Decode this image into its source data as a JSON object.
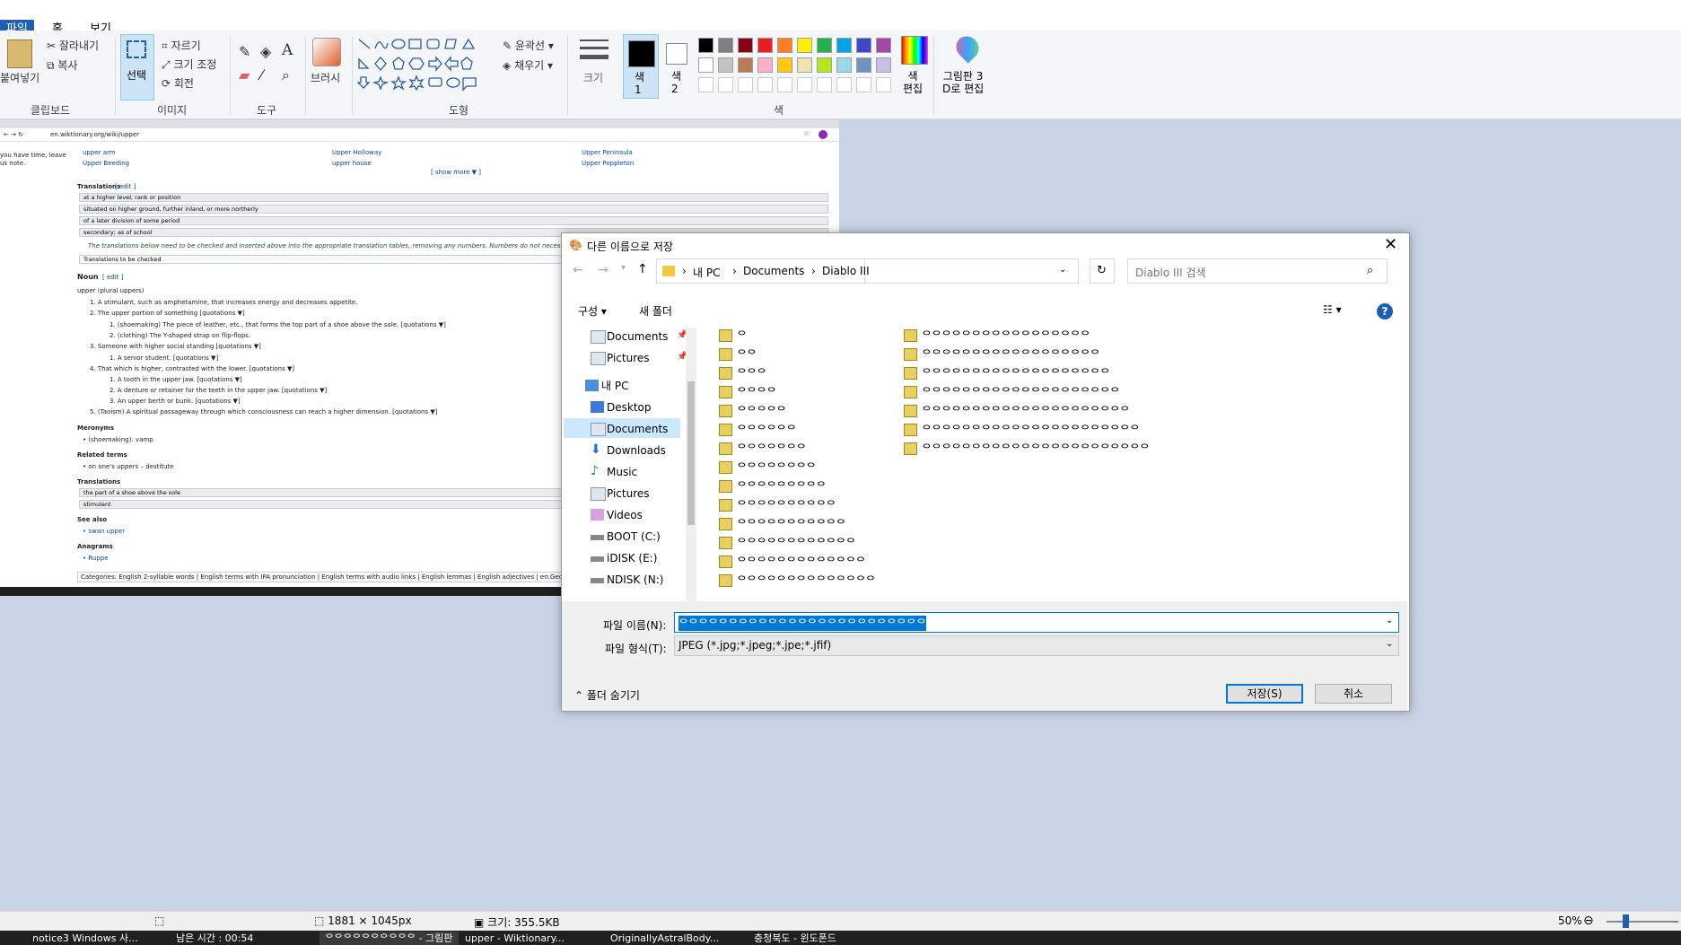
{
  "ribbon": {
    "tabs": [
      "파일",
      "홈",
      "보기"
    ],
    "clipboard": {
      "paste": "붙여넣기",
      "cut": "잘라내기",
      "copy": "복사",
      "group": "클립보드"
    },
    "image": {
      "select": "선택",
      "crop": "자르기",
      "resize": "크기 조정",
      "rotate": "회전",
      "group": "이미지"
    },
    "tools": {
      "group": "도구"
    },
    "brushes": {
      "label": "브러시"
    },
    "shapes": {
      "outline": "윤곽선",
      "fill": "채우기",
      "group": "도형"
    },
    "size": {
      "label": "크기"
    },
    "color1": {
      "label": "색\n1"
    },
    "color2": {
      "label": "색\n2"
    },
    "colors_group": "색",
    "edit_colors": "색\n편집",
    "paint3d": "그림판 3\nD로 편집",
    "palette_row1": [
      "#000000",
      "#7f7f7f",
      "#880015",
      "#ed1c24",
      "#ff7f27",
      "#fff200",
      "#22b14c",
      "#00a2e8",
      "#3f48cc",
      "#a349a4"
    ],
    "palette_row2": [
      "#ffffff",
      "#c3c3c3",
      "#b97a57",
      "#ffaec9",
      "#ffc90e",
      "#efe4b0",
      "#b5e61d",
      "#99d9ea",
      "#7092be",
      "#c8bfe7"
    ]
  },
  "wiki": {
    "url": "en.wiktionary.org/wiki/upper",
    "left_note": "you have time, leave us note.",
    "links_col1": [
      "upper arm",
      "Upper Beeding"
    ],
    "links_col2": [
      "Upper Holloway",
      "upper house"
    ],
    "links_col3": [
      "Upper Peninsula",
      "Upper Poppleton"
    ],
    "show_more": "[ show more ▼ ]",
    "translations_head": "Translations",
    "translations": [
      "at a higher level, rank or position",
      "situated on higher ground, further inland, or more northerly",
      "of a later division of some period",
      "secondary; as of school"
    ],
    "translation_note": "The translations below need to be checked and inserted above into the appropriate translation tables, removing any numbers. Numbers do not necessarily match th",
    "to_check": "Translations to be checked",
    "noun_head": "Noun",
    "noun_line": "upper (plural uppers)",
    "senses": [
      "1. A stimulant, such as amphetamine, that increases energy and decreases appetite.",
      "2. The upper portion of something  [quotations ▼]",
      "1. (shoemaking) The piece of leather, etc., that forms the top part of a shoe above the sole.  [quotations ▼]",
      "2. (clothing) The Y-shaped strap on flip-flops.",
      "3. Someone with higher social standing  [quotations ▼]",
      "1. A senior student.  [quotations ▼]",
      "4. That which is higher, contrasted with the lower.  [quotations ▼]",
      "1. A tooth in the upper jaw.  [quotations ▼]",
      "2. A denture or retainer for the teeth in the upper jaw.  [quotations ▼]",
      "3. An upper berth or bunk.  [quotations ▼]",
      "5. (Taoism) A spiritual passageway through which consciousness can reach a higher dimension.  [quotations ▼]"
    ],
    "meronyms_head": "Meronyms",
    "meronyms": "• (shoemaking): vamp",
    "related_head": "Related terms",
    "related": "• on one's uppers – destitute",
    "translations2_head": "Translations",
    "translations2": [
      "the part of a shoe above the sole",
      "stimulant"
    ],
    "seealso_head": "See also",
    "seealso": "• swan upper",
    "anagrams_head": "Anagrams",
    "anagrams": "• Ruppe",
    "categories": "Categories:  English 2-syllable words  |  English terms with IPA pronunciation  |  English terms with audio links  |  English lemmas  |  English adjectives  |  en:Geology  |  en:Edu",
    "edit": "[ edit ]",
    "show": "[show ▼]"
  },
  "dialog": {
    "title": "다른 이름으로 저장",
    "breadcrumb": [
      "내 PC",
      "Documents",
      "Diablo III"
    ],
    "search_placeholder": "Diablo III 검색",
    "organize": "구성 ▾",
    "new_folder": "새 폴더",
    "nav_items": [
      "Documents",
      "Pictures",
      "내 PC",
      "Desktop",
      "Documents",
      "Downloads",
      "Music",
      "Pictures",
      "Videos",
      "BOOT (C:)",
      "iDISK (E:)",
      "NDISK (N:)"
    ],
    "files_col1": [
      "ᄋ",
      "ᄋᄋ",
      "ᄋᄋᄋ",
      "ᄋᄋᄋᄋ",
      "ᄋᄋᄋᄋᄋ",
      "ᄋᄋᄋᄋᄋᄋ",
      "ᄋᄋᄋᄋᄋᄋᄋ",
      "ᄋᄋᄋᄋᄋᄋᄋᄋ",
      "ᄋᄋᄋᄋᄋᄋᄋᄋᄋ",
      "ᄋᄋᄋᄋᄋᄋᄋᄋᄋᄋ",
      "ᄋᄋᄋᄋᄋᄋᄋᄋᄋᄋᄋ",
      "ᄋᄋᄋᄋᄋᄋᄋᄋᄋᄋᄋᄋ",
      "ᄋᄋᄋᄋᄋᄋᄋᄋᄋᄋᄋᄋᄋ",
      "ᄋᄋᄋᄋᄋᄋᄋᄋᄋᄋᄋᄋᄋᄋ"
    ],
    "files_col2": [
      "ᄋᄋᄋᄋᄋᄋᄋᄋᄋᄋᄋᄋᄋᄋᄋᄋᄋ",
      "ᄋᄋᄋᄋᄋᄋᄋᄋᄋᄋᄋᄋᄋᄋᄋᄋᄋᄋ",
      "ᄋᄋᄋᄋᄋᄋᄋᄋᄋᄋᄋᄋᄋᄋᄋᄋᄋᄋᄋ",
      "ᄋᄋᄋᄋᄋᄋᄋᄋᄋᄋᄋᄋᄋᄋᄋᄋᄋᄋᄋᄋ",
      "ᄋᄋᄋᄋᄋᄋᄋᄋᄋᄋᄋᄋᄋᄋᄋᄋᄋᄋᄋᄋᄋ",
      "ᄋᄋᄋᄋᄋᄋᄋᄋᄋᄋᄋᄋᄋᄋᄋᄋᄋᄋᄋᄋᄋᄋ",
      "ᄋᄋᄋᄋᄋᄋᄋᄋᄋᄋᄋᄋᄋᄋᄋᄋᄋᄋᄋᄋᄋᄋᄋ"
    ],
    "filename_label": "파일 이름(N):",
    "filename_value": "ᄋᄋᄋᄋᄋᄋᄋᄋᄋᄋᄋᄋᄋᄋᄋᄋᄋᄋᄋᄋᄋᄋᄋᄋᄋ",
    "filetype_label": "파일 형식(T):",
    "filetype_value": "JPEG (*.jpg;*.jpeg;*.jpe;*.jfif)",
    "hide_folders": "폴더 숨기기",
    "save": "저장(S)",
    "cancel": "취소"
  },
  "status": {
    "dimensions": "1881 × 1045px",
    "size": "크기: 355.5KB",
    "zoom": "50%"
  },
  "taskbar": {
    "items": [
      "notice3 Windows 사...",
      "남은 시간 : 00:54",
      "ᄋᄋᄋᄋᄋᄋᄋᄋᄋᄋ - 그림판",
      "upper - Wiktionary...",
      "OriginallyAstralBody...",
      "충청북도 - 윈도폰드"
    ]
  },
  "colors": {
    "accent": "#1e5fb4",
    "selection": "#0078d7",
    "canvas_bg": "#c8d4e6"
  }
}
